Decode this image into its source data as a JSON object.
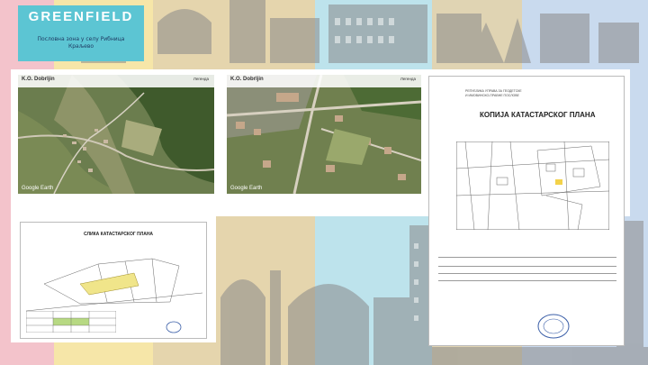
{
  "banner": {
    "title": "GREENFIELD",
    "subtitle_line1": "Пословна зона у селу Рибница",
    "subtitle_line2": "Краљево"
  },
  "aerial_left": {
    "location": "K.O. Dobrljin",
    "legend": "Легенда"
  },
  "aerial_right": {
    "location": "K.O. Dobrljin",
    "legend": "Легенда"
  },
  "cadastral_right": {
    "header_line1": "РЕПУБЛИКА УПРАВА ЗА ГЕОДЕТСКЕ",
    "header_line2": "И ИМОВИНСКО-ПРАВНЕ ПОСЛОВЕ",
    "title": "КОПИЈА КАТАСТАРСКОГ ПЛАНА"
  },
  "cadastral_left": {
    "title": "СЛИКА КАТАСТАРСКОГ ПЛАНА"
  },
  "aerial_label": "Google Earth",
  "colors": {
    "title_box": "#5cc5d3",
    "band_pink": "#f4c7cf",
    "band_yellow": "#f6e9a9",
    "band_tan": "#e3d2a7",
    "band_cyan": "#b9e5ee",
    "band_blue": "#c6d9ee"
  }
}
